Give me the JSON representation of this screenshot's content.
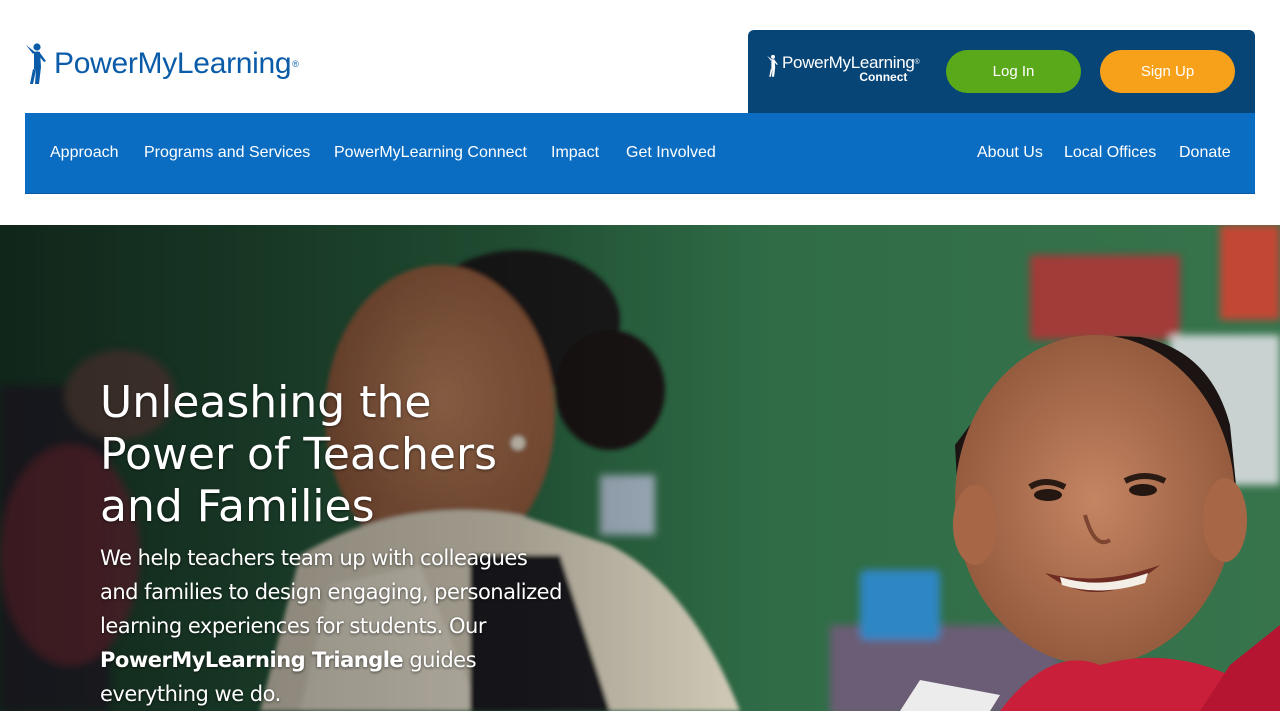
{
  "brand": {
    "name": "PowerMyLearning",
    "registered_mark": "®",
    "color": "#0b5ca8"
  },
  "connect_panel": {
    "logo_main": "PowerMyLearning",
    "logo_registered": "®",
    "logo_sub": "Connect",
    "background": "#074577",
    "login_label": "Log In",
    "login_color": "#5aa91a",
    "signup_label": "Sign Up",
    "signup_color": "#f7a11b"
  },
  "nav": {
    "background": "#0b6dc2",
    "left_items": [
      {
        "label": "Approach"
      },
      {
        "label": "Programs and Services"
      },
      {
        "label": "PowerMyLearning Connect"
      },
      {
        "label": "Impact"
      },
      {
        "label": "Get Involved"
      }
    ],
    "right_items": [
      {
        "label": "About Us"
      },
      {
        "label": "Local Offices"
      },
      {
        "label": "Donate"
      }
    ]
  },
  "hero": {
    "title_lines": [
      "Unleashing the",
      "Power of Teachers",
      "and Families"
    ],
    "body_before_link": "We help teachers team up with colleagues and families to design engaging, personalized learning experiences for students. Our ",
    "body_link": "PowerMyLearning Triangle",
    "body_after_link": " guides everything we do.",
    "background_image": "classroom-photo-teacher-and-smiling-student"
  }
}
